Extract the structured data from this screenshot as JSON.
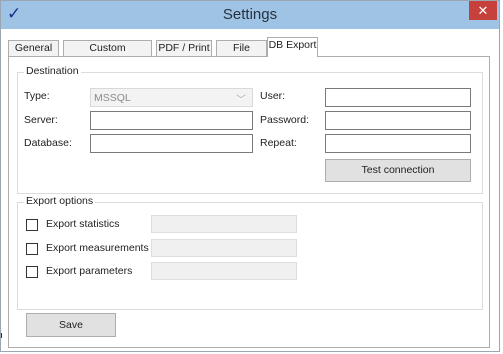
{
  "window": {
    "title": "Settings",
    "close_glyph": "✕",
    "app_icon": "checkmark-logo-icon"
  },
  "tabs": [
    {
      "label": "General",
      "active": false
    },
    {
      "label": "Custom parameters",
      "active": false
    },
    {
      "label": "PDF / Print",
      "active": false
    },
    {
      "label": "File Export",
      "active": false
    },
    {
      "label": "DB Export",
      "active": true
    }
  ],
  "destination": {
    "legend": "Destination",
    "type_label": "Type:",
    "type_value": "MSSQL",
    "server_label": "Server:",
    "server_value": "",
    "database_label": "Database:",
    "database_value": "",
    "user_label": "User:",
    "user_value": "",
    "password_label": "Password:",
    "password_value": "",
    "repeat_label": "Repeat:",
    "repeat_value": "",
    "test_button": "Test connection"
  },
  "export_options": {
    "legend": "Export options",
    "items": [
      {
        "label": "Export statistics",
        "checked": false
      },
      {
        "label": "Export measurements",
        "checked": false
      },
      {
        "label": "Export parameters",
        "checked": false
      }
    ]
  },
  "footer": {
    "save_button": "Save"
  },
  "colors": {
    "titlebar": "#9ec3e5",
    "close": "#c6413b",
    "accent": "#1b2f8f"
  }
}
